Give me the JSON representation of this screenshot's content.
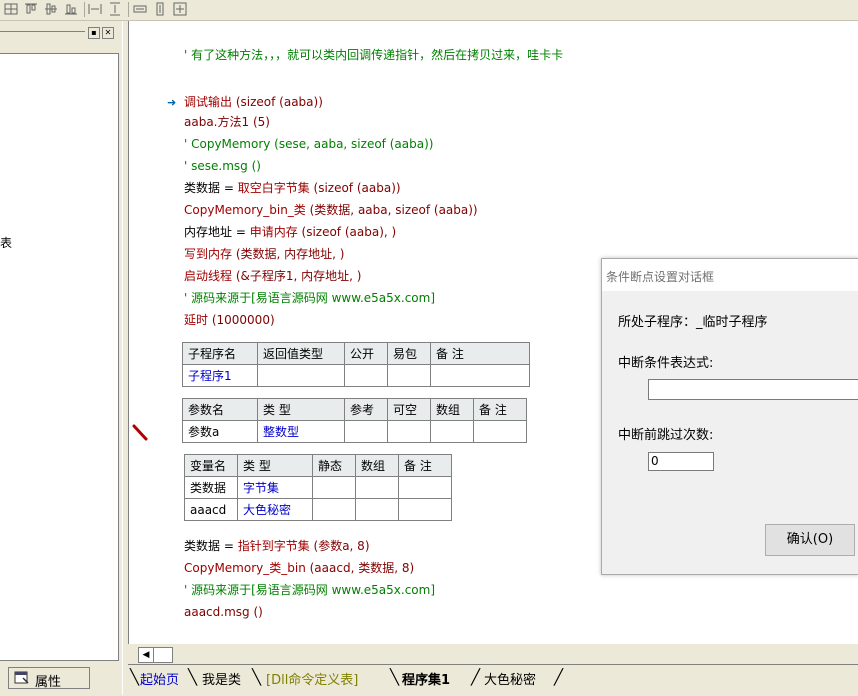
{
  "toolbar": {
    "icons": [
      "table-insert-icon",
      "align-top-icon",
      "align-middle-icon",
      "align-bottom-icon",
      "horizontal-space-icon",
      "vertical-space-icon",
      "same-width-icon",
      "same-height-icon",
      "same-size-icon"
    ]
  },
  "left_panel": {
    "partial_text": "表",
    "properties_tab": "属性"
  },
  "code": {
    "comment_top": "' 有了这种方法，，，就可以类内回调传递指针，然后在拷贝过来，哇卡卡",
    "debug_line": {
      "cmd": "调试输出",
      "args": " (sizeof (aaba))"
    },
    "method_line": "aaba.方法1 (5)",
    "comment_copy": "' CopyMemory (sese, aaba, sizeof (aaba))",
    "comment_msg": "' sese.msg ()",
    "assign_bytes": {
      "left": "类数据 = ",
      "cmd": "取空白字节集",
      "args": " (sizeof (aaba))"
    },
    "copy_bin": {
      "cmd": "CopyMemory_bin_类",
      "args": " (类数据, aaba, sizeof (aaba))"
    },
    "alloc_line": {
      "left": "内存地址 = ",
      "cmd": "申请内存",
      "args": " (sizeof (aaba), )"
    },
    "write_mem": {
      "cmd": "写到内存",
      "args": " (类数据, 内存地址, )"
    },
    "start_thread": {
      "cmd": "启动线程",
      "args": " (&子程序1, 内存地址, )"
    },
    "comment_source1": "' 源码来源于[易语言源码网 www.e5a5x.com]",
    "delay_line": {
      "cmd": "延时",
      "args": " (1000000)"
    },
    "pointer_line": {
      "left": "类数据 = ",
      "cmd": "指针到字节集",
      "args": " (参数a, 8)"
    },
    "copy_cls": {
      "cmd": "CopyMemory_类_bin",
      "args": " (aaacd, 类数据, 8)"
    },
    "comment_source2": "' 源码来源于[易语言源码网 www.e5a5x.com]",
    "msg_line": "aaacd.msg ()"
  },
  "sub_table": {
    "headers": [
      "子程序名",
      "返回值类型",
      "公开",
      "易包",
      "备 注"
    ],
    "row": [
      "子程序1",
      "",
      "",
      "",
      ""
    ]
  },
  "param_table": {
    "headers": [
      "参数名",
      "类 型",
      "参考",
      "可空",
      "数组",
      "备 注"
    ],
    "row": [
      "参数a",
      "整数型",
      "",
      "",
      "",
      ""
    ]
  },
  "var_table": {
    "headers": [
      "变量名",
      "类 型",
      "静态",
      "数组",
      "备 注"
    ],
    "rows": [
      [
        "类数据",
        "字节集",
        "",
        "",
        ""
      ],
      [
        "aaacd",
        "大色秘密",
        "",
        "",
        ""
      ]
    ]
  },
  "tabs": [
    "起始页",
    "我是类",
    "[Dll命令定义表]",
    "程序集1",
    "大色秘密"
  ],
  "dialog": {
    "title": "条件断点设置对话框",
    "sub_label": "所处子程序：_临时子程序",
    "expr_label": "中断条件表达式:",
    "expr_value": "",
    "skip_label": "中断前跳过次数:",
    "skip_value": "0",
    "ok_label": "确认(O)"
  }
}
